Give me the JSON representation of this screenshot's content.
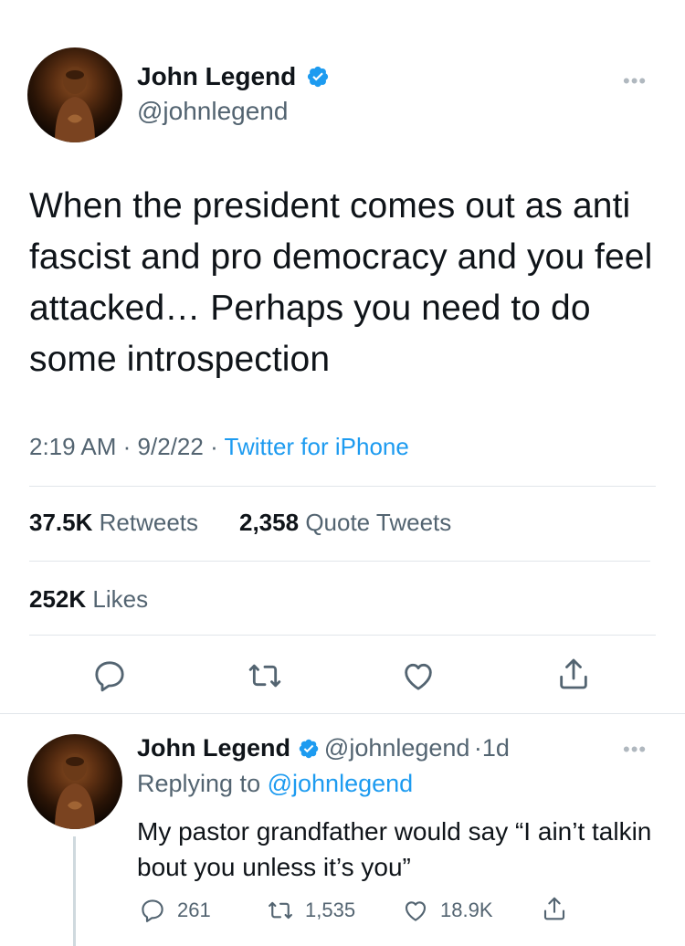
{
  "tweet": {
    "author": {
      "name": "John Legend",
      "handle": "@johnlegend",
      "verified": true
    },
    "more_icon": "more-horizontal-icon",
    "text": "When the president comes out as anti fascist and pro democracy and you feel attacked… Perhaps you need to do some introspection",
    "time": "2:19 AM",
    "separator": "·",
    "date": "9/2/22",
    "source": "Twitter for iPhone",
    "stats": {
      "retweets_count": "37.5K",
      "retweets_label": "Retweets",
      "quotes_count": "2,358",
      "quotes_label": "Quote Tweets",
      "likes_count": "252K",
      "likes_label": "Likes"
    },
    "actions": [
      "reply-icon",
      "retweet-icon",
      "like-icon",
      "share-icon"
    ]
  },
  "reply": {
    "author": {
      "name": "John Legend",
      "handle": "@johnlegend",
      "age": "1d",
      "verified": true
    },
    "replying_prefix": "Replying to",
    "replying_to": "@johnlegend",
    "text": "My pastor grandfather would say “I ain’t talkin bout you unless it’s you”",
    "counts": {
      "replies": "261",
      "retweets": "1,535",
      "likes": "18.9K"
    }
  },
  "colors": {
    "accent": "#1d9bf0",
    "text": "#0f1419",
    "secondary": "#536471",
    "divider": "#e1e6ea"
  }
}
